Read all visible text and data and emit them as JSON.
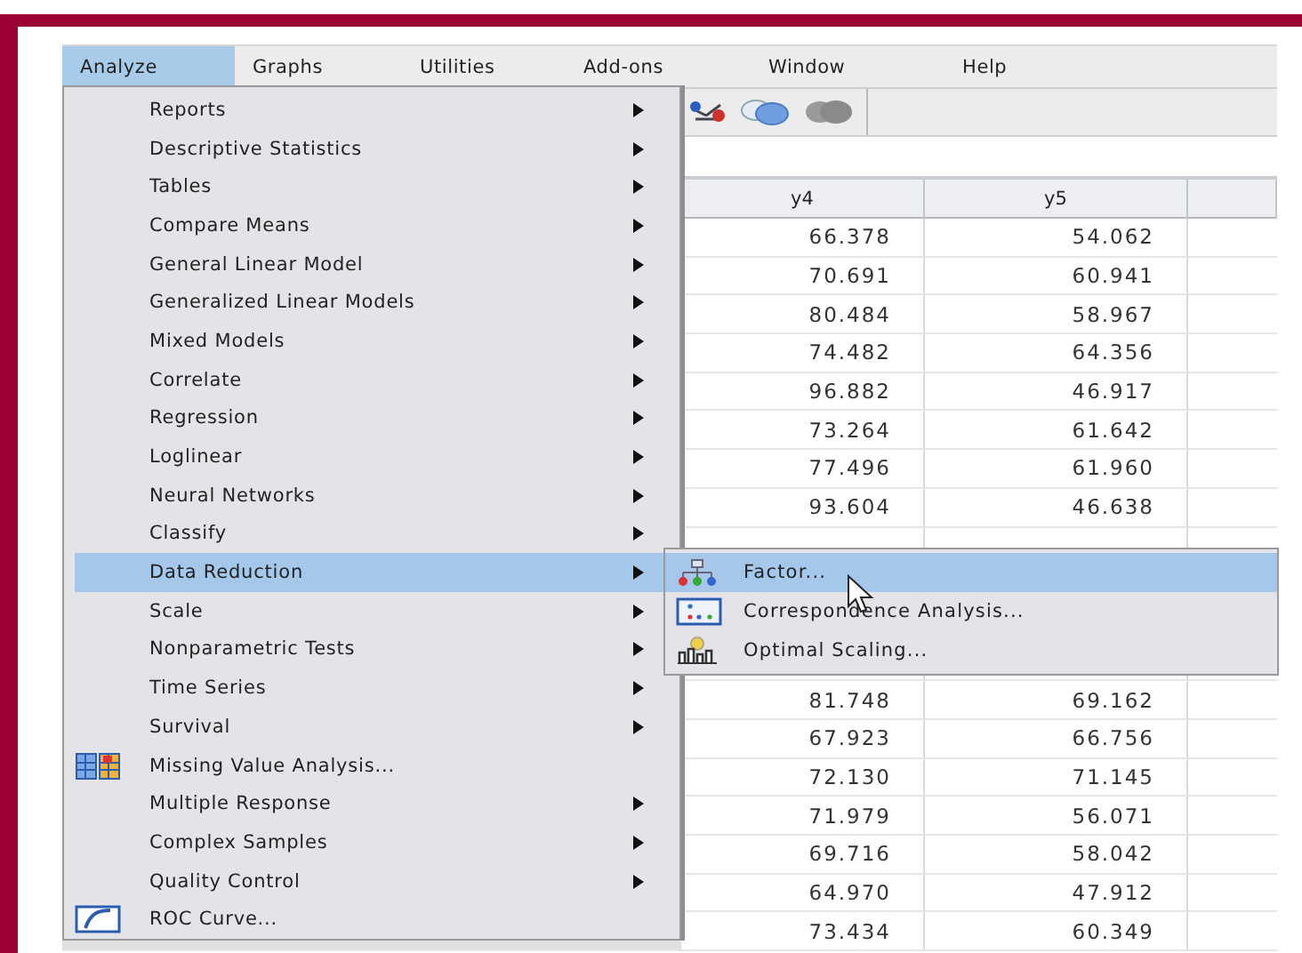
{
  "menubar": [
    {
      "label": "Analyze",
      "selected": true
    },
    {
      "label": "Graphs",
      "selected": false
    },
    {
      "label": "Utilities",
      "selected": false
    },
    {
      "label": "Add-ons",
      "selected": false
    },
    {
      "label": "Window",
      "selected": false
    },
    {
      "label": "Help",
      "selected": false
    }
  ],
  "analyze_menu": [
    {
      "label": "Reports",
      "kind": "submenu",
      "selected": false
    },
    {
      "label": "Descriptive Statistics",
      "kind": "submenu",
      "selected": false
    },
    {
      "label": "Tables",
      "kind": "submenu",
      "selected": false
    },
    {
      "label": "Compare Means",
      "kind": "submenu",
      "selected": false
    },
    {
      "label": "General Linear Model",
      "kind": "submenu",
      "selected": false
    },
    {
      "label": "Generalized Linear Models",
      "kind": "submenu",
      "selected": false
    },
    {
      "label": "Mixed Models",
      "kind": "submenu",
      "selected": false
    },
    {
      "label": "Correlate",
      "kind": "submenu",
      "selected": false
    },
    {
      "label": "Regression",
      "kind": "submenu",
      "selected": false
    },
    {
      "label": "Loglinear",
      "kind": "submenu",
      "selected": false
    },
    {
      "label": "Neural Networks",
      "kind": "submenu",
      "selected": false
    },
    {
      "label": "Classify",
      "kind": "submenu",
      "selected": false
    },
    {
      "label": "Data Reduction",
      "kind": "submenu",
      "selected": true
    },
    {
      "label": "Scale",
      "kind": "submenu",
      "selected": false
    },
    {
      "label": "Nonparametric Tests",
      "kind": "submenu",
      "selected": false
    },
    {
      "label": "Time Series",
      "kind": "submenu",
      "selected": false
    },
    {
      "label": "Survival",
      "kind": "submenu",
      "selected": false
    },
    {
      "label": "Missing Value Analysis...",
      "kind": "dialog",
      "selected": false
    },
    {
      "label": "Multiple Response",
      "kind": "submenu",
      "selected": false
    },
    {
      "label": "Complex Samples",
      "kind": "submenu",
      "selected": false
    },
    {
      "label": "Quality Control",
      "kind": "submenu",
      "selected": false
    },
    {
      "label": "ROC Curve...",
      "kind": "dialog",
      "selected": false
    }
  ],
  "data_reduction_submenu": [
    {
      "label": "Factor...",
      "kind": "dialog",
      "selected": true
    },
    {
      "label": "Correspondence Analysis...",
      "kind": "dialog",
      "selected": false
    },
    {
      "label": "Optimal Scaling...",
      "kind": "dialog",
      "selected": false
    }
  ],
  "table": {
    "columns": [
      "y4",
      "y5"
    ],
    "rows_above_submenu": [
      [
        "66.378",
        "54.062"
      ],
      [
        "70.691",
        "60.941"
      ],
      [
        "80.484",
        "58.967"
      ],
      [
        "74.482",
        "64.356"
      ],
      [
        "96.882",
        "46.917"
      ],
      [
        "73.264",
        "61.642"
      ],
      [
        "77.496",
        "61.960"
      ],
      [
        "93.604",
        "46.638"
      ]
    ],
    "rows_below_submenu": [
      [
        "81.748",
        "69.162"
      ],
      [
        "67.923",
        "66.756"
      ],
      [
        "72.130",
        "71.145"
      ],
      [
        "71.979",
        "56.071"
      ],
      [
        "69.716",
        "58.042"
      ],
      [
        "64.970",
        "47.912"
      ],
      [
        "73.434",
        "60.349"
      ]
    ]
  }
}
